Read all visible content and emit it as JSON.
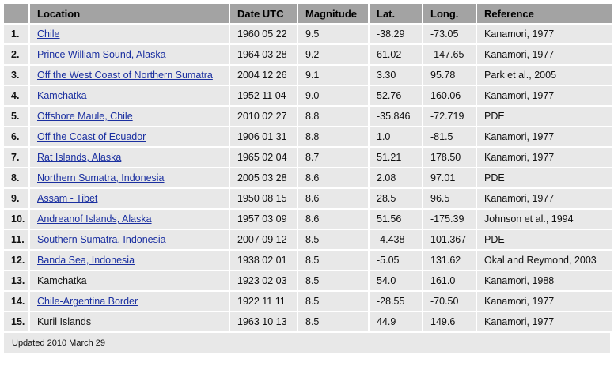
{
  "table": {
    "headers": [
      "",
      "Location",
      "Date UTC",
      "Magnitude",
      "Lat.",
      "Long.",
      "Reference"
    ],
    "rows": [
      {
        "rank": "1.",
        "location": "Chile",
        "link": true,
        "date": "1960 05 22",
        "magnitude": "9.5",
        "lat": "-38.29",
        "long": "-73.05",
        "reference": "Kanamori, 1977"
      },
      {
        "rank": "2.",
        "location": "Prince William Sound, Alaska",
        "link": true,
        "date": "1964 03 28",
        "magnitude": "9.2",
        "lat": "61.02",
        "long": "-147.65",
        "reference": "Kanamori, 1977"
      },
      {
        "rank": "3.",
        "location": "Off the West Coast of Northern Sumatra",
        "link": true,
        "date": "2004 12 26",
        "magnitude": "9.1",
        "lat": "3.30",
        "long": "95.78",
        "reference": "Park et al., 2005"
      },
      {
        "rank": "4.",
        "location": "Kamchatka",
        "link": true,
        "date": "1952 11 04",
        "magnitude": "9.0",
        "lat": "52.76",
        "long": "160.06",
        "reference": "Kanamori, 1977"
      },
      {
        "rank": "5.",
        "location": "Offshore Maule, Chile",
        "link": true,
        "date": "2010 02 27",
        "magnitude": "8.8",
        "lat": "-35.846",
        "long": "-72.719",
        "reference": "PDE"
      },
      {
        "rank": "6.",
        "location": "Off the Coast of Ecuador",
        "link": true,
        "date": "1906 01 31",
        "magnitude": "8.8",
        "lat": "1.0",
        "long": "-81.5",
        "reference": "Kanamori, 1977"
      },
      {
        "rank": "7.",
        "location": "Rat Islands, Alaska",
        "link": true,
        "date": "1965 02 04",
        "magnitude": "8.7",
        "lat": "51.21",
        "long": "178.50",
        "reference": "Kanamori, 1977"
      },
      {
        "rank": "8.",
        "location": "Northern Sumatra, Indonesia",
        "link": true,
        "date": "2005 03 28",
        "magnitude": "8.6",
        "lat": "2.08",
        "long": "97.01",
        "reference": "PDE"
      },
      {
        "rank": "9.",
        "location": "Assam - Tibet",
        "link": true,
        "date": "1950 08 15",
        "magnitude": "8.6",
        "lat": "28.5",
        "long": "96.5",
        "reference": "Kanamori, 1977"
      },
      {
        "rank": "10.",
        "location": "Andreanof Islands, Alaska",
        "link": true,
        "date": "1957 03 09",
        "magnitude": "8.6",
        "lat": "51.56",
        "long": "-175.39",
        "reference": "Johnson et al., 1994"
      },
      {
        "rank": "11.",
        "location": "Southern Sumatra, Indonesia",
        "link": true,
        "date": "2007 09 12",
        "magnitude": "8.5",
        "lat": "-4.438",
        "long": "101.367",
        "reference": "PDE"
      },
      {
        "rank": "12.",
        "location": "Banda Sea, Indonesia",
        "link": true,
        "date": "1938 02 01",
        "magnitude": "8.5",
        "lat": "-5.05",
        "long": "131.62",
        "reference": "Okal and Reymond, 2003"
      },
      {
        "rank": "13.",
        "location": "Kamchatka",
        "link": false,
        "date": "1923 02 03",
        "magnitude": "8.5",
        "lat": "54.0",
        "long": "161.0",
        "reference": "Kanamori, 1988"
      },
      {
        "rank": "14.",
        "location": "Chile-Argentina Border",
        "link": true,
        "date": "1922 11 11",
        "magnitude": "8.5",
        "lat": "-28.55",
        "long": "-70.50",
        "reference": "Kanamori, 1977"
      },
      {
        "rank": "15.",
        "location": "Kuril Islands",
        "link": false,
        "date": "1963 10 13",
        "magnitude": "8.5",
        "lat": "44.9",
        "long": "149.6",
        "reference": "Kanamori, 1977"
      }
    ]
  },
  "footer": {
    "updated": "Updated 2010 March 29"
  },
  "colors": {
    "header_bg": "#a3a3a3",
    "row_bg": "#e8e8e8",
    "link": "#1a2fa0"
  }
}
